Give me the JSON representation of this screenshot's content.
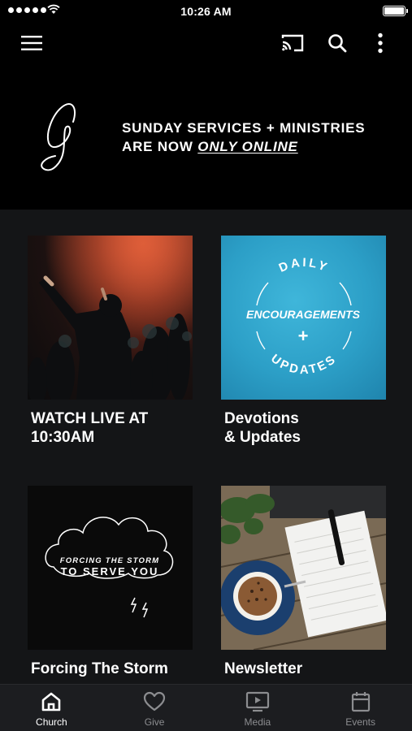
{
  "status_bar": {
    "time": "10:26 AM"
  },
  "app_bar": {
    "icons": [
      "menu-icon",
      "cast-icon",
      "search-icon",
      "more-vertical-icon"
    ]
  },
  "banner": {
    "line1": "SUNDAY SERVICES + MINISTRIES",
    "line2_prefix": "ARE NOW ",
    "line2_emphasis": "ONLY ONLINE"
  },
  "cards": [
    {
      "title_line1": "WATCH LIVE AT",
      "title_line2": "10:30AM"
    },
    {
      "title_line1": "Devotions",
      "title_line2": "& Updates",
      "art": {
        "top": "DAILY",
        "middle": "ENCOURAGEMENTS",
        "plus": "+",
        "bottom": "UPDATES"
      }
    },
    {
      "title_line1": "Forcing The Storm",
      "title_line2": "",
      "art": {
        "line1": "FORCING THE STORM",
        "line2": "TO SERVE YOU"
      }
    },
    {
      "title_line1": "Newsletter",
      "title_line2": ""
    }
  ],
  "tabs": [
    {
      "label": "Church",
      "icon": "home-icon",
      "active": true
    },
    {
      "label": "Give",
      "icon": "heart-icon",
      "active": false
    },
    {
      "label": "Media",
      "icon": "media-play-icon",
      "active": false
    },
    {
      "label": "Events",
      "icon": "calendar-icon",
      "active": false
    }
  ],
  "colors": {
    "background": "#000000",
    "content_background": "#141517",
    "tab_bar": "#1c1d20",
    "tab_inactive": "#8c8d90",
    "devotions_blue": "#2c9fc7"
  }
}
